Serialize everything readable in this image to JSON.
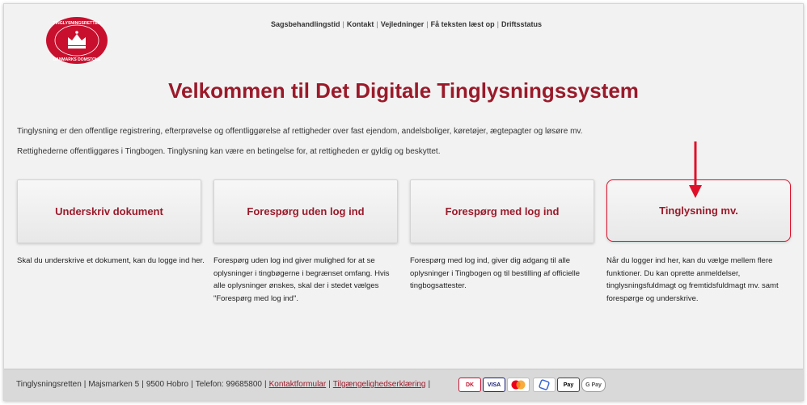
{
  "header": {
    "logo": {
      "top_text": "TINGLYSNINGSRETTEN",
      "bottom_text": "DANMARKS DOMSTOLE"
    },
    "nav": [
      {
        "label": "Sagsbehandlingstid"
      },
      {
        "label": "Kontakt"
      },
      {
        "label": "Vejledninger"
      },
      {
        "label": "Få teksten læst op"
      },
      {
        "label": "Driftsstatus"
      }
    ]
  },
  "main": {
    "title": "Velkommen til Det Digitale Tinglysningssystem",
    "intro1": "Tinglysning er den offentlige registrering, efterprøvelse og offentliggørelse af rettigheder over fast ejendom, andelsboliger, køretøjer, ægtepagter og løsøre mv.",
    "intro2": "Rettighederne offentliggøres i Tingbogen. Tinglysning kan være en betingelse for, at rettigheden er gyldig og beskyttet.",
    "cards": [
      {
        "label": "Underskriv dokument",
        "desc": "Skal du underskrive et dokument, kan du logge ind her."
      },
      {
        "label": "Forespørg uden log ind",
        "desc": "Forespørg uden log ind giver mulighed for at se oplysninger i tingbøgerne i begrænset omfang. Hvis alle oplysninger ønskes, skal der i stedet vælges \"Forespørg med log ind\"."
      },
      {
        "label": "Forespørg med log ind",
        "desc": "Forespørg med log ind, giver dig adgang til alle oplysninger i Tingbogen og til bestilling af officielle tingbogsattester."
      },
      {
        "label": "Tinglysning mv.",
        "desc": "Når du logger ind her, kan du vælge mellem flere funktioner. Du kan oprette anmeldelser, tinglysningsfuldmagt og fremtidsfuldmagt mv. samt forespørge og underskrive."
      }
    ]
  },
  "footer": {
    "org": "Tinglysningsretten",
    "address": "Majsmarken 5",
    "city": "9500 Hobro",
    "phone": "Telefon: 99685800",
    "contact_link": "Kontaktformular",
    "accessibility_link": "Tilgængelighedserklæring",
    "payment_labels": [
      "DK",
      "VISA",
      "MC",
      "",
      "Pay",
      "G Pay"
    ]
  },
  "colors": {
    "brand_red": "#9a1a2a",
    "highlight_red": "#e0102a",
    "footer_bg": "#d9d9d9"
  }
}
